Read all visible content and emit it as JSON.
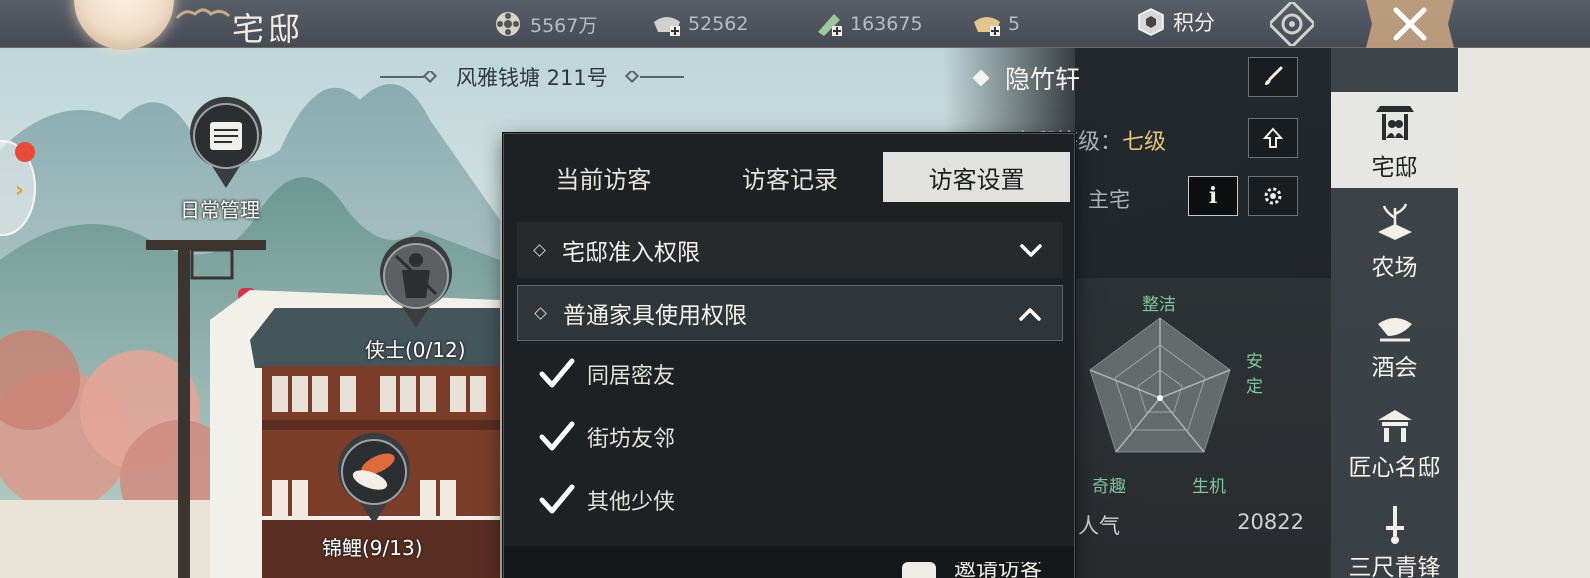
{
  "header": {
    "title": "宅邸",
    "resources": [
      {
        "icon": "film-reel-icon",
        "value": "5567万"
      },
      {
        "icon": "silver-ingot-plus-icon",
        "value": "52562"
      },
      {
        "icon": "jade-ticket-plus-icon",
        "value": "163675"
      },
      {
        "icon": "gold-ingot-plus-icon",
        "value": "5"
      }
    ],
    "points_label": "积分"
  },
  "map": {
    "address": "风雅钱塘 211号",
    "pins": [
      {
        "label": "日常管理",
        "icon": "scroll-icon"
      },
      {
        "label": "侠士(0/12)",
        "icon": "swordsman-icon"
      },
      {
        "label": "锦鲤(9/13)",
        "icon": "koi-fish-icon"
      }
    ]
  },
  "popup": {
    "tabs": [
      "当前访客",
      "访客记录",
      "访客设置"
    ],
    "active_tab": 2,
    "sections": [
      {
        "title": "宅邸准入权限",
        "expanded": false
      },
      {
        "title": "普通家具使用权限",
        "expanded": true
      }
    ],
    "options": [
      {
        "label": "同居密友",
        "checked": true
      },
      {
        "label": "街坊友邻",
        "checked": true
      },
      {
        "label": "其他少侠",
        "checked": true
      }
    ],
    "invite_label": "邀请访客"
  },
  "info_panel": {
    "house_name": "隐竹轩",
    "level_label": "宅邸等级：",
    "level_value": "七级",
    "type": "主宅",
    "radar_labels": {
      "top": "整洁",
      "right": "安定",
      "bottom_right": "生机",
      "bottom_left": "奇趣"
    },
    "stat_label": "人气",
    "stat_value": "20822"
  },
  "nav": {
    "items": [
      "宅邸",
      "农场",
      "酒会",
      "匠心名邸",
      "三尺青锋"
    ],
    "active": 0
  }
}
